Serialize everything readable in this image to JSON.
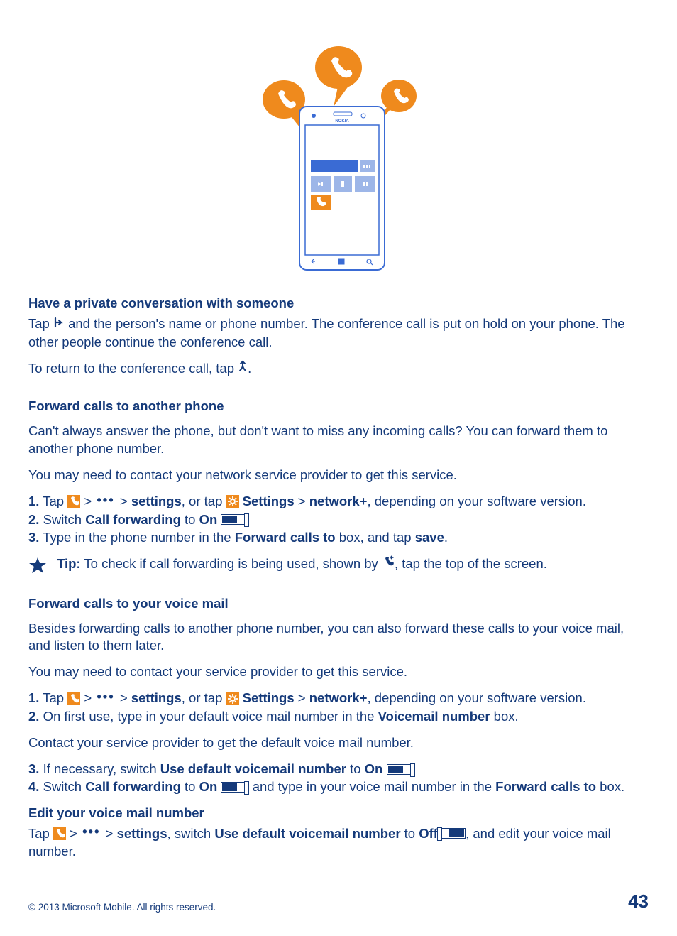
{
  "section1": {
    "heading": "Have a private conversation with someone",
    "p1a": "Tap ",
    "p1b": " and the person's name or phone number. The conference call is put on hold on your phone. The other people continue the conference call.",
    "p2a": "To return to the conference call, tap ",
    "p2b": "."
  },
  "section2": {
    "heading": "Forward calls to another phone",
    "p1": "Can't always answer the phone, but don't want to miss any incoming calls? You can forward them to another phone number.",
    "p2": "You may need to contact your network service provider to get this service.",
    "step1": {
      "num": "1.",
      "a": " Tap ",
      "b": " > ",
      "c": " > ",
      "settings": "settings",
      "d": ", or tap ",
      "Settings": "Settings",
      "e": " > ",
      "network": "network+",
      "f": ", depending on your software version."
    },
    "step2": {
      "num": "2.",
      "a": " Switch ",
      "cf": "Call forwarding",
      "b": " to ",
      "on": "On",
      "c": " ",
      "d": "."
    },
    "step3": {
      "num": "3.",
      "a": " Type in the phone number in the ",
      "fct": "Forward calls to",
      "b": " box, and tap ",
      "save": "save",
      "c": "."
    },
    "tip": {
      "label": "Tip:",
      "a": " To check if call forwarding is being used, shown by ",
      "b": ", tap the top of the screen."
    }
  },
  "section3": {
    "heading": "Forward calls to your voice mail",
    "p1": "Besides forwarding calls to another phone number, you can also forward these calls to your voice mail, and listen to them later.",
    "p2": "You may need to contact your service provider to get this service.",
    "step1": {
      "num": "1.",
      "a": " Tap ",
      "b": " > ",
      "c": " > ",
      "settings": "settings",
      "d": ", or tap ",
      "Settings": "Settings",
      "e": " > ",
      "network": "network+",
      "f": ", depending on your software version."
    },
    "step2": {
      "num": "2.",
      "a": " On first use, type in your default voice mail number in the ",
      "vn": "Voicemail number",
      "b": " box."
    },
    "p3": "Contact your service provider to get the default voice mail number.",
    "step3": {
      "num": "3.",
      "a": " If necessary, switch ",
      "udvn": "Use default voicemail number",
      "b": " to ",
      "on": "On",
      "c": " ",
      "d": "."
    },
    "step4": {
      "num": "4.",
      "a": " Switch ",
      "cf": "Call forwarding",
      "b": " to ",
      "on": "On",
      "c": " ",
      "d": ", and type in your voice mail number in the ",
      "fct": "Forward calls to",
      "e": " box."
    }
  },
  "section4": {
    "heading": "Edit your voice mail number",
    "p1a": "Tap ",
    "p1b": " > ",
    "p1c": " > ",
    "settings": "settings",
    "p1d": ", switch ",
    "udvn": "Use default voicemail number",
    "p1e": " to ",
    "off": "Off",
    "p1f": " ",
    "p1g": ", and edit your voice mail number."
  },
  "footer": {
    "copyright": "© 2013 Microsoft Mobile. All rights reserved.",
    "page": "43"
  }
}
